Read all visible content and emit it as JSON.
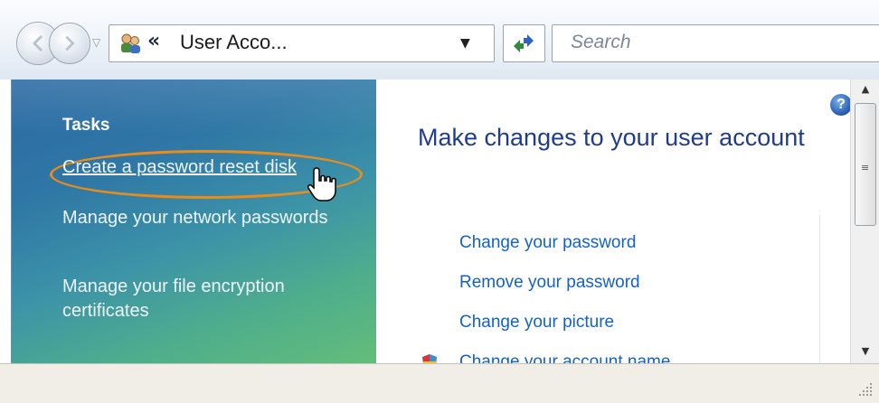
{
  "nav": {
    "back_icon": "back-arrow-icon",
    "forward_icon": "forward-arrow-icon",
    "history_icon": "chevron-down-icon"
  },
  "address": {
    "icon": "user-accounts-icon",
    "separator": "«",
    "text": "User Acco...",
    "dropdown_icon": "dropdown-arrow-icon"
  },
  "refresh_icon": "refresh-icon",
  "search": {
    "placeholder": "Search"
  },
  "tasks": {
    "title": "Tasks",
    "links": [
      "Create a password reset disk",
      "Manage your network passwords",
      "Manage your file encryption certificates"
    ]
  },
  "content": {
    "title": "Make changes to your user account",
    "actions": [
      "Change your password",
      "Remove your password",
      "Change your picture",
      "Change your account name"
    ]
  },
  "colors": {
    "link_blue": "#1462c2",
    "title_blue": "#1f3d8c",
    "highlight_orange": "#e88d1b"
  }
}
